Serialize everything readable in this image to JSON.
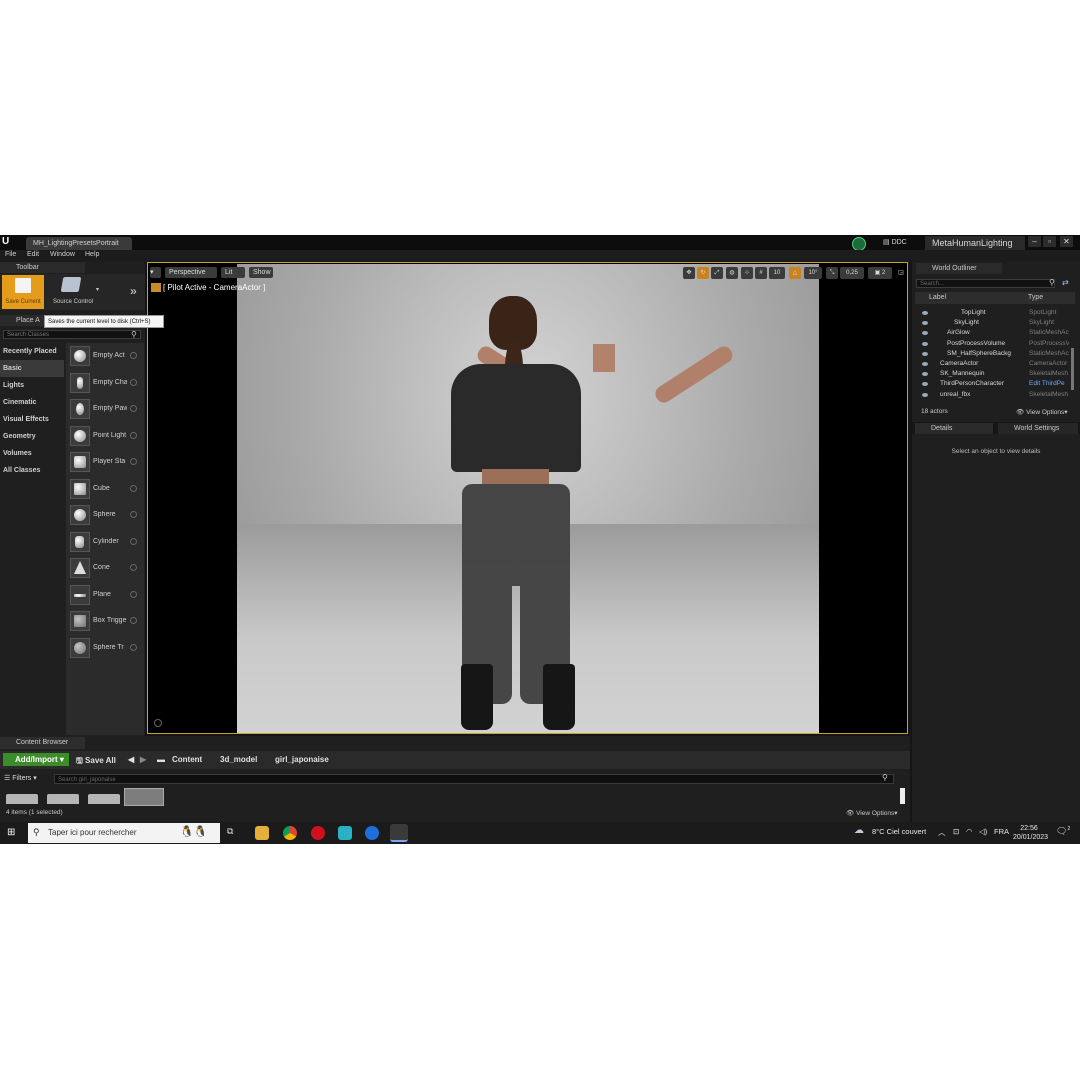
{
  "window": {
    "tab_title": "MH_LightingPresetsPortrait",
    "ddc_label": "DDC",
    "project_name": "MetaHumanLighting",
    "buttons": [
      "–",
      "▫",
      "✕"
    ]
  },
  "menu": [
    "File",
    "Edit",
    "Window",
    "Help"
  ],
  "toolbar": {
    "tab_label": "Toolbar",
    "save_label": "Save Current",
    "source_control_label": "Source Control",
    "tooltip": "Saves the current level to disk (Ctrl+S)"
  },
  "place_actors": {
    "tab_label": "Place A",
    "search_placeholder": "Search Classes",
    "categories": [
      "Recently Placed",
      "Basic",
      "Lights",
      "Cinematic",
      "Visual Effects",
      "Geometry",
      "Volumes",
      "All Classes"
    ],
    "selected_category": "Basic",
    "items": [
      "Empty Act",
      "Empty Cha",
      "Empty Paw",
      "Point Light",
      "Player Sta",
      "Cube",
      "Sphere",
      "Cylinder",
      "Cone",
      "Plane",
      "Box Trigge",
      "Sphere Tr"
    ]
  },
  "viewport": {
    "perspective_label": "Perspective",
    "lit_label": "Lit",
    "show_label": "Show",
    "pilot_label": "[ Pilot Active - CameraActor ]",
    "grid_snap": "10",
    "rot_snap": "10°",
    "scale_snap": "0,25",
    "camera_speed": "2"
  },
  "world_outliner": {
    "tab_label": "World Outliner",
    "search_placeholder": "Search...",
    "col_label": "Label",
    "col_type": "Type",
    "rows": [
      {
        "label": "TopLight",
        "type": "SpotLight",
        "indent": 3
      },
      {
        "label": "SkyLight",
        "type": "SkyLight",
        "indent": 2
      },
      {
        "label": "AirGlow",
        "type": "StaticMeshAc",
        "indent": 1
      },
      {
        "label": "PostProcessVolume",
        "type": "PostProcessV",
        "indent": 1
      },
      {
        "label": "SM_HalfSphereBackg",
        "type": "StaticMeshAc",
        "indent": 1
      },
      {
        "label": "CameraActor",
        "type": "CameraActor",
        "indent": 0
      },
      {
        "label": "SK_Mannequin",
        "type": "SkeletalMesh",
        "indent": 0
      },
      {
        "label": "ThirdPersonCharacter",
        "type": "Edit ThirdPe",
        "indent": 0,
        "link": true
      },
      {
        "label": "unreal_fbx",
        "type": "SkeletalMesh",
        "indent": 0
      }
    ],
    "actor_count": "18 actors",
    "view_options": "View Options"
  },
  "details": {
    "tab_details": "Details",
    "tab_world_settings": "World Settings",
    "empty_text": "Select an object to view details"
  },
  "content_browser": {
    "tab_label": "Content Browser",
    "add_import": "Add/Import",
    "save_all": "Save All",
    "breadcrumb": [
      "Content",
      "3d_model",
      "girl_japonaise"
    ],
    "filters_label": "Filters",
    "search_placeholder": "Search girl_japonaise",
    "status": "4 items (1 selected)",
    "view_options": "View Options"
  },
  "taskbar": {
    "search_placeholder": "Taper ici pour rechercher",
    "weather": "8°C  Ciel couvert",
    "language": "FRA",
    "time": "22:56",
    "date": "20/01/2023",
    "notif_count": "2"
  },
  "colors": {
    "accent_orange": "#e59c1c",
    "add_green": "#3b8d29",
    "viewport_border": "#c9a227",
    "link_blue": "#6fa8ff"
  }
}
